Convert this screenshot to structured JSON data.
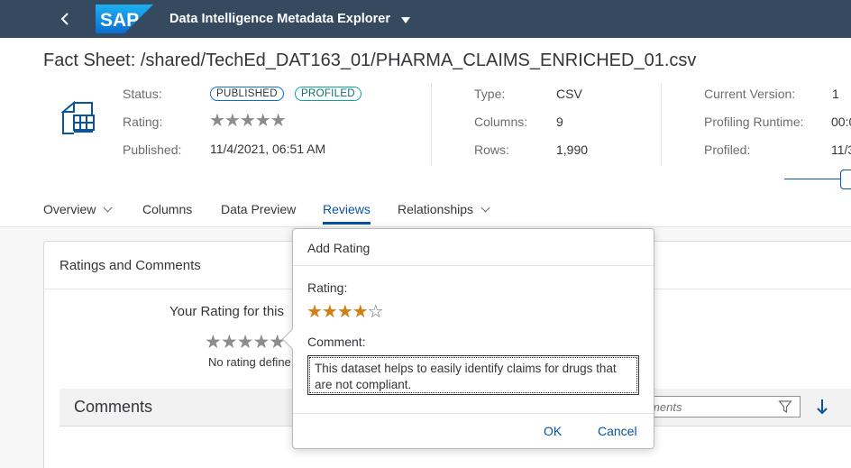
{
  "shell": {
    "logo_text": "SAP",
    "app_title": "Data Intelligence Metadata Explorer"
  },
  "header": {
    "title": "Fact Sheet: /shared/TechEd_DAT163_01/PHARMA_CLAIMS_ENRICHED_01.csv",
    "status_label": "Status:",
    "badges": [
      "PUBLISHED",
      "PROFILED"
    ],
    "rating_label": "Rating:",
    "rating_stars": "★★★★★",
    "published_label": "Published:",
    "published_value": "11/4/2021, 06:51 AM",
    "type_label": "Type:",
    "type_value": "CSV",
    "columns_label": "Columns:",
    "columns_value": "9",
    "rows_label": "Rows:",
    "rows_value": "1,990",
    "version_label": "Current Version:",
    "version_value": "1",
    "runtime_label": "Profiling Runtime:",
    "runtime_value": "00:0",
    "profiled_label": "Profiled:",
    "profiled_value": "11/3"
  },
  "tabs": [
    "Overview",
    "Columns",
    "Data Preview",
    "Reviews",
    "Relationships"
  ],
  "card": {
    "title": "Ratings and Comments",
    "your_rating": "Your Rating for this",
    "stars": "★★★★★",
    "no_rating": "No rating define",
    "comments_title": "Comments",
    "search_placeholder": "omments"
  },
  "popover": {
    "title": "Add Rating",
    "rating_label": "Rating:",
    "rating_value": 4,
    "rating_max": 5,
    "stars_on": "★★★★",
    "stars_off": "☆",
    "comment_label": "Comment:",
    "comment_value": "This dataset helps to easily identify claims for drugs that are not compliant.",
    "ok_label": "OK",
    "cancel_label": "Cancel"
  },
  "colors": {
    "shell": "#354a5f",
    "accent": "#0854a0",
    "star_active": "#d08014"
  }
}
